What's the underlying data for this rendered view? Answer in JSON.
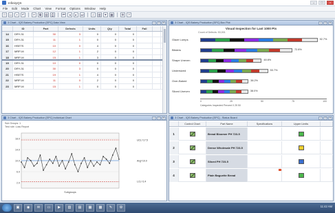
{
  "app": {
    "title": "InfinityQS",
    "menu": [
      "File",
      "Edit",
      "Mode",
      "Chart",
      "View",
      "Format",
      "Options",
      "Window",
      "Help"
    ]
  },
  "toolbar": {
    "buttons": [
      {
        "name": "new-icon",
        "glyph": "□"
      },
      {
        "name": "open-icon",
        "glyph": "▭"
      },
      {
        "name": "save-icon",
        "glyph": "▪"
      },
      {
        "name": "undo-icon",
        "glyph": "↶"
      },
      {
        "name": "cut-icon",
        "glyph": "✂"
      },
      {
        "name": "copy-icon",
        "glyph": "⧉"
      },
      {
        "name": "paste-icon",
        "glyph": "▤"
      },
      {
        "name": "print-icon",
        "glyph": "⎙"
      },
      {
        "name": "first-icon",
        "glyph": "⏮"
      },
      {
        "name": "prev-icon",
        "glyph": "◂"
      },
      {
        "name": "next-icon",
        "glyph": "▸"
      },
      {
        "name": "last-icon",
        "glyph": "⏭"
      },
      {
        "name": "zoom-icon",
        "glyph": "⌕"
      },
      {
        "name": "chart-icon",
        "glyph": "▥"
      },
      {
        "name": "filter-icon",
        "glyph": "⏷"
      },
      {
        "name": "grid-icon",
        "glyph": "▦"
      },
      {
        "name": "settings-icon",
        "glyph": "⚙"
      },
      {
        "name": "help-icon",
        "glyph": "?"
      }
    ]
  },
  "windows": {
    "table": {
      "title": "3 Chart - IQS Bakery Production [SPC] Data View",
      "columns": [
        "ID",
        "Part",
        "Defects",
        "Defects",
        "Units",
        "Qty",
        "Total",
        "Fail"
      ],
      "rows": [
        {
          "id": "14",
          "part": "DRY-31",
          "c1": "30",
          "c2": "3",
          "c3": "0",
          "c4": "0",
          "c5": "0"
        },
        {
          "id": "15",
          "part": "DRY-31",
          "c1": "11",
          "c2": "1",
          "c3": "0",
          "c4": "0",
          "c5": "0"
        },
        {
          "id": "16",
          "part": "HSETS",
          "c1": "10",
          "c2": "0",
          "c3": "4",
          "c4": "0",
          "c5": "0"
        },
        {
          "id": "17",
          "part": "MRP-M",
          "c1": "12",
          "c2": "1",
          "c3": "2",
          "c4": "0",
          "c5": "0"
        },
        {
          "id": "18",
          "part": "MRP-M",
          "c1": "15",
          "c2": "1",
          "c3": "3",
          "c4": "0",
          "c5": "0"
        },
        {
          "id": "19",
          "part": "DRY-31",
          "c1": "10",
          "c2": "0",
          "c3": "0",
          "c4": "0",
          "c5": "0"
        },
        {
          "id": "20",
          "part": "DRY-31",
          "c1": "30",
          "c2": "3",
          "c3": "0",
          "c4": "0",
          "c5": "0"
        },
        {
          "id": "21",
          "part": "HSETS",
          "c1": "19",
          "c2": "1",
          "c3": "4",
          "c4": "0",
          "c5": "0"
        },
        {
          "id": "22",
          "part": "MRP-M",
          "c1": "11",
          "c2": "0",
          "c3": "2",
          "c4": "0",
          "c5": "0"
        },
        {
          "id": "23",
          "part": "MRP-M",
          "c1": "15",
          "c2": "1",
          "c3": "0",
          "c4": "0",
          "c5": "0"
        }
      ]
    },
    "bars": {
      "title": "3 Chart - IQS Bakery Production [SPC] Box Plot",
      "heading": "Visual Inspection for Last 1000 Pts",
      "subheading": "Count of Defects: 53,001",
      "footer": "Categories Inspected   Percent  0  25  50",
      "axis_ticks": [
        "0",
        "25",
        "50",
        "75",
        "100"
      ]
    },
    "line": {
      "title": "3 Chart - IQS Bakery Production [SPC] Individual Chart",
      "meta_line1": "Sub Groups: 1",
      "meta_line2": "Test rule: Loss Report"
    },
    "status": {
      "title": "3 Chart - IQS Bakery Production [SPC] - Status Board",
      "columns": [
        "",
        "Control Chart",
        "Part Name",
        "Specifications",
        "Upper Limits",
        ""
      ],
      "rows": [
        {
          "idx": "1",
          "name": "Bread Bloomer PH 723-5",
          "status": "green"
        },
        {
          "idx": "2",
          "name": "Dense Wholesale PH 723-5",
          "status": "yellow"
        },
        {
          "idx": "3",
          "name": "Sliced PH 723-5",
          "status": "blue"
        },
        {
          "idx": "4",
          "name": "Plain Baguette Bread",
          "status": "green"
        }
      ]
    }
  },
  "chart_data": [
    {
      "type": "bar",
      "title": "Visual Inspection for Last 1000 Pts",
      "categories": [
        "Glaze Lumps",
        "Blisters",
        "Shape Uneven",
        "Undersized",
        "Over-Baked",
        "Sliced Uneven"
      ],
      "values": [
        92.7,
        72.8,
        48.6,
        53.7,
        38.2,
        38.0
      ],
      "labels": [
        "92.7%",
        "72.8%",
        "48.6%",
        "53.7%",
        "38.2%",
        "38.0%"
      ],
      "segment_colors": [
        "#1f3d8c",
        "#2aa04a",
        "#111111",
        "#8a2be2",
        "#2a7be0",
        "#7aa84f",
        "#c23a2b",
        "#e8e8e8"
      ],
      "colors": {
        "accent": "#2aa04a"
      }
    },
    {
      "type": "line",
      "title": "Individuals",
      "ylim": [
        0.0,
        20.0
      ],
      "y_ticks": [
        "18.0",
        "14.0",
        "10.0",
        "6.0",
        "2.0"
      ],
      "x_label": "Subgroups",
      "limits": {
        "ucl": "UCL=17.5",
        "mean": "Avg=10.0",
        "lcl": "LCL=2.4"
      },
      "x": [
        1,
        2,
        3,
        4,
        5,
        6,
        7,
        8,
        9,
        10,
        11,
        12,
        13,
        14,
        15,
        16,
        17,
        18,
        19,
        20,
        21,
        22,
        23,
        24,
        25,
        26,
        27,
        28,
        29,
        30,
        31,
        32
      ],
      "values": [
        9.5,
        7.5,
        11.0,
        10.0,
        8.0,
        9.0,
        12.0,
        6.5,
        8.5,
        10.5,
        9.0,
        11.5,
        8.0,
        10.0,
        7.0,
        9.5,
        12.5,
        8.5,
        6.0,
        9.0,
        11.0,
        7.5,
        10.0,
        8.0,
        9.5,
        8.5,
        11.5,
        10.5,
        9.0,
        12.0,
        14.5,
        10.5
      ],
      "line_color": "#333333"
    }
  ],
  "taskbar": {
    "tasks": [
      {
        "name": "explorer-icon",
        "glyph": "▣"
      },
      {
        "name": "browser-icon",
        "glyph": "◉"
      },
      {
        "name": "mail-icon",
        "glyph": "✉"
      },
      {
        "name": "folder-icon",
        "glyph": "▭"
      },
      {
        "name": "media-icon",
        "glyph": "▶"
      },
      {
        "name": "app-icon",
        "glyph": "▥"
      },
      {
        "name": "doc-icon",
        "glyph": "▤"
      },
      {
        "name": "chart-app-icon",
        "glyph": "▦"
      },
      {
        "name": "calc-icon",
        "glyph": "▩"
      },
      {
        "name": "paint-icon",
        "glyph": "✎"
      },
      {
        "name": "tool-icon",
        "glyph": "⚙"
      }
    ],
    "tray": "11:42 AM"
  }
}
